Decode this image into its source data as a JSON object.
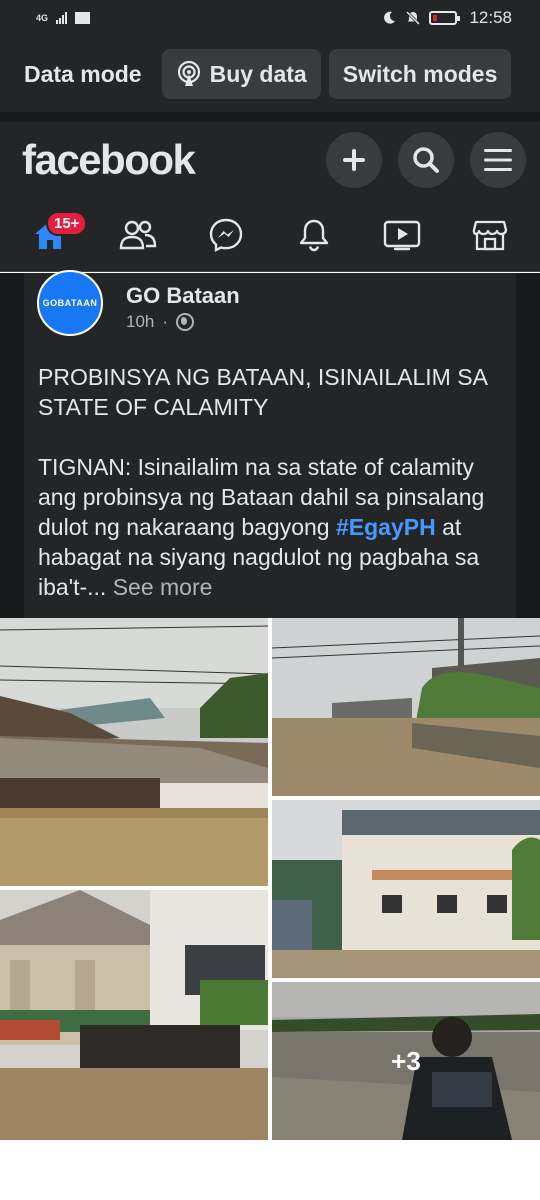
{
  "status_bar": {
    "network": "4G",
    "time": "12:58",
    "icons": [
      "signal-icon",
      "mail-icon",
      "moon-icon",
      "mute-icon",
      "battery-low-icon"
    ],
    "battery_color": "#e02020"
  },
  "data_mode": {
    "label": "Data mode",
    "buy_data": "Buy data",
    "switch_modes": "Switch modes"
  },
  "header": {
    "logo": "facebook",
    "actions": [
      "add-icon",
      "search-icon",
      "menu-icon"
    ]
  },
  "nav": {
    "items": [
      "home-icon",
      "friends-icon",
      "messenger-icon",
      "notifications-icon",
      "watch-icon",
      "marketplace-icon"
    ],
    "home_badge": "15+",
    "active": "home",
    "accent": "#2d88ff"
  },
  "post": {
    "avatar_text": "GOBATAAN",
    "author": "GO Bataan",
    "time": "10h",
    "dot": "·",
    "headline": "PROBINSYA NG BATAAN, ISINAILALIM SA STATE OF CALAMITY",
    "body_before": "TIGNAN: Isinailalim na sa state of calamity ang probinsya ng Bataan dahil sa pinsalang dulot ng nakaraang bagyong ",
    "hashtag": "#EgayPH",
    "body_after": " at habagat na siyang nagdulot ng pagbaha sa iba't-...",
    "see_more": "See more"
  },
  "photos": {
    "count_more": "+3"
  }
}
